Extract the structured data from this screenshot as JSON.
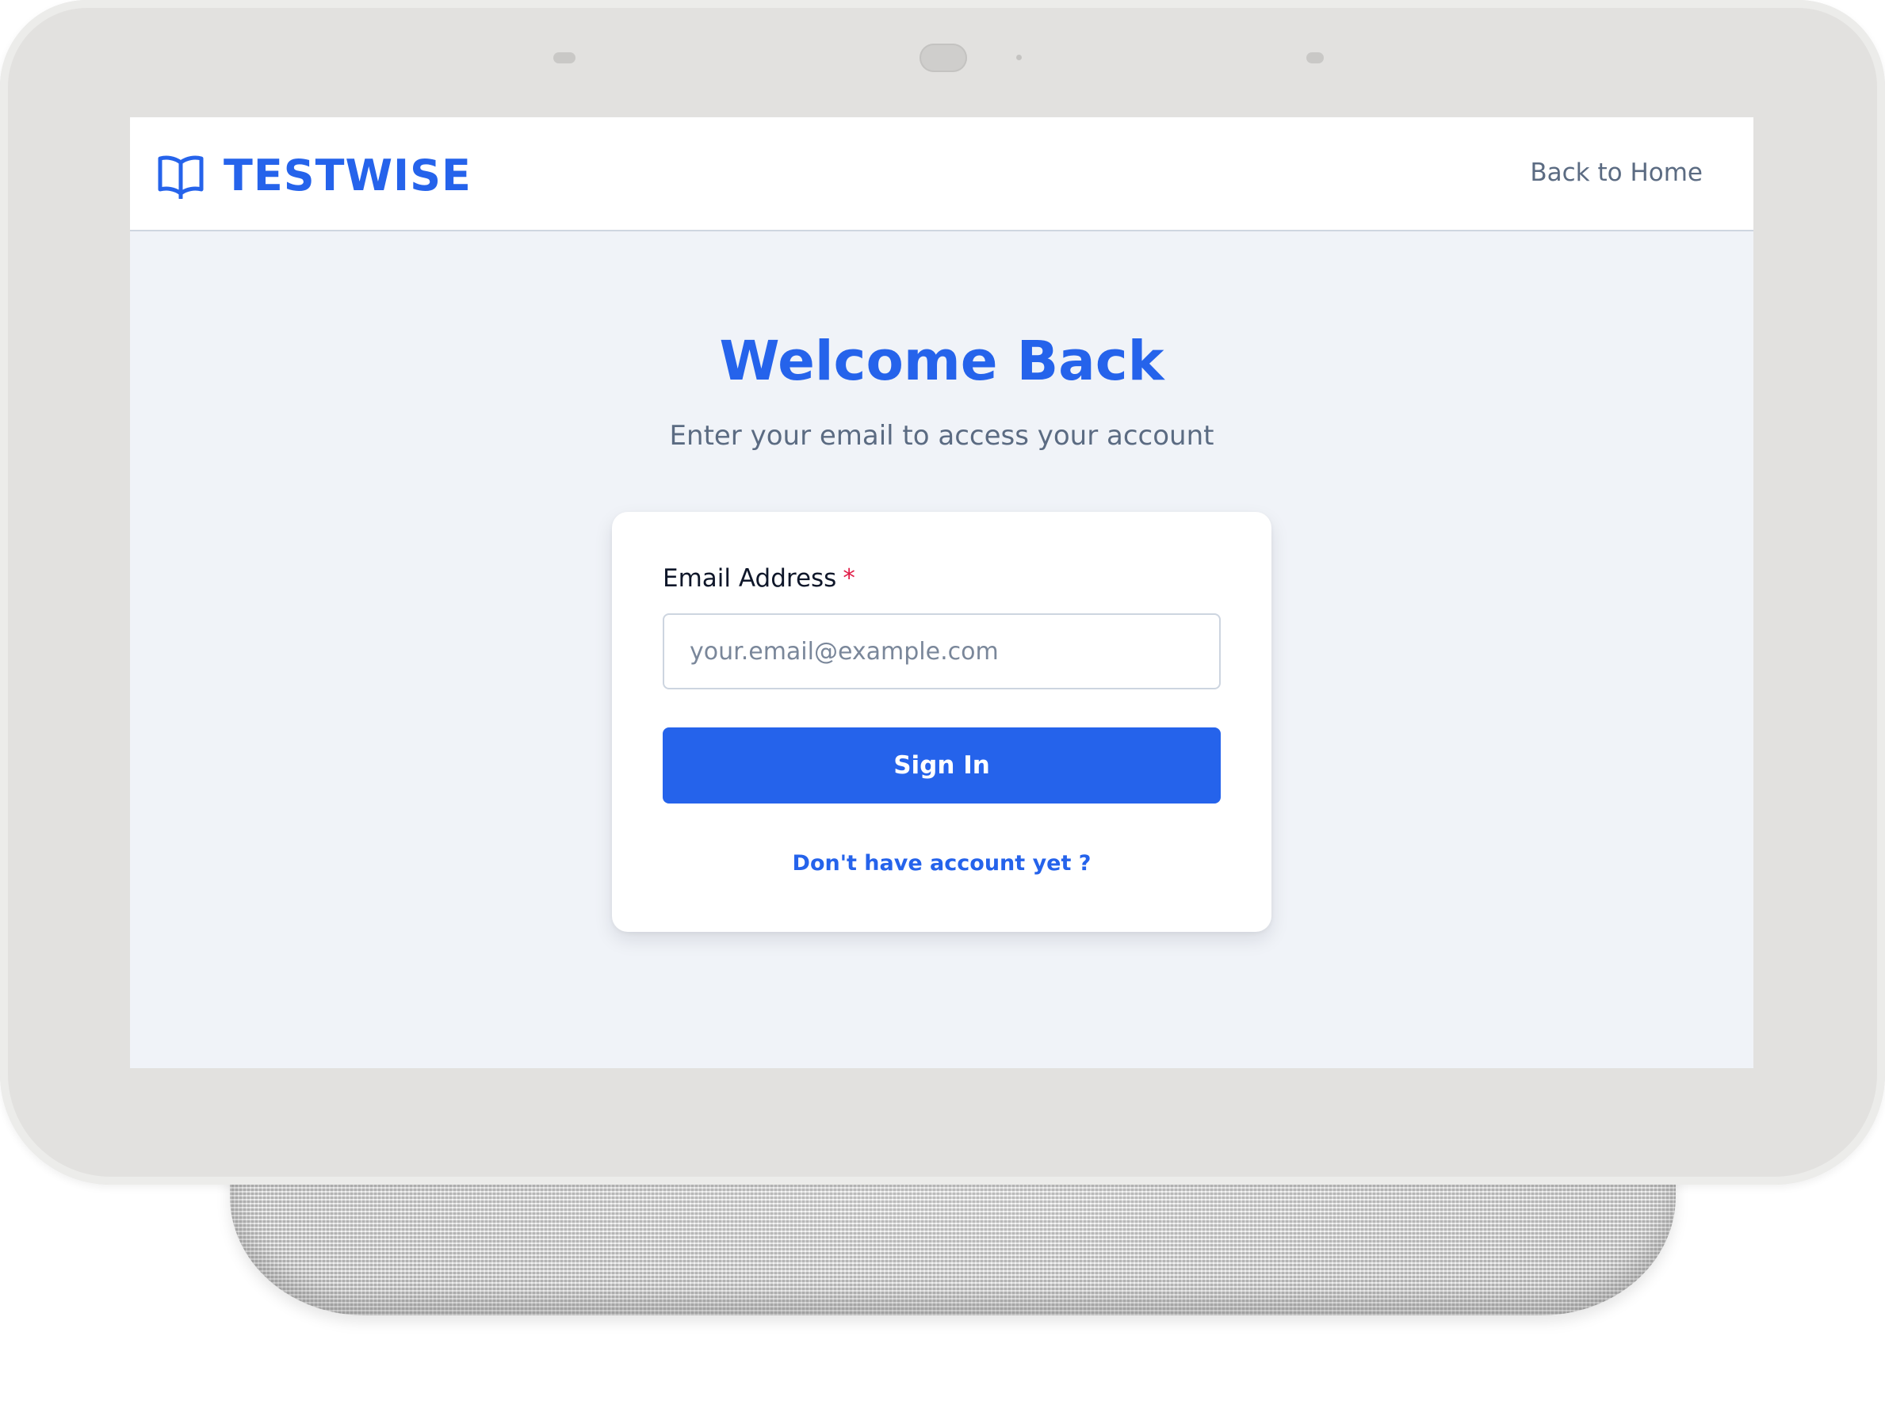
{
  "header": {
    "brand_name": "TESTWISE",
    "brand_icon": "open-book-icon",
    "back_link": "Back to Home"
  },
  "main": {
    "title": "Welcome Back",
    "subtitle": "Enter your email to access your account"
  },
  "login_form": {
    "email_label": "Email Address",
    "required_marker": "*",
    "email_value": "",
    "email_placeholder": "your.email@example.com",
    "submit_label": "Sign In",
    "signup_link": "Don't have account yet ?"
  },
  "colors": {
    "brand": "#2563eb",
    "page_background": "#f0f3f8",
    "card_background": "#ffffff",
    "muted_text": "#5b6b82",
    "required": "#e11d48",
    "device_frame": "#e2e1df"
  }
}
